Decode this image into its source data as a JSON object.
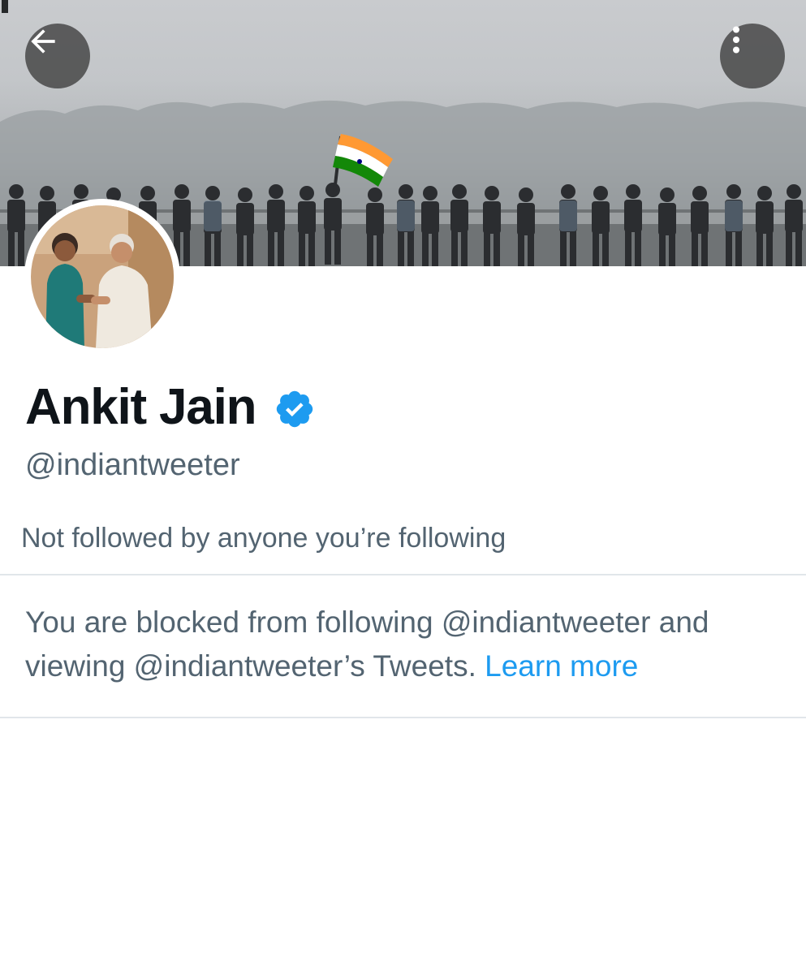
{
  "header": {
    "back_icon": "arrow-left-icon",
    "more_icon": "more-vertical-icon",
    "banner_description": "",
    "flag_colors": {
      "saffron": "#ff9933",
      "white": "#ffffff",
      "green": "#138808",
      "chakra": "#000080"
    }
  },
  "profile": {
    "display_name": "Ankit Jain",
    "verified": true,
    "verified_icon": "verified-badge-icon",
    "verified_color": "#1d9bf0",
    "handle": "@indiantweeter",
    "followed_by_text": "Not followed by anyone you’re following"
  },
  "notice": {
    "text": "You are blocked from following @indiantweeter and viewing @indiantweeter’s Tweets.",
    "learn_more_label": "Learn more",
    "link_color": "#1d9bf0"
  }
}
